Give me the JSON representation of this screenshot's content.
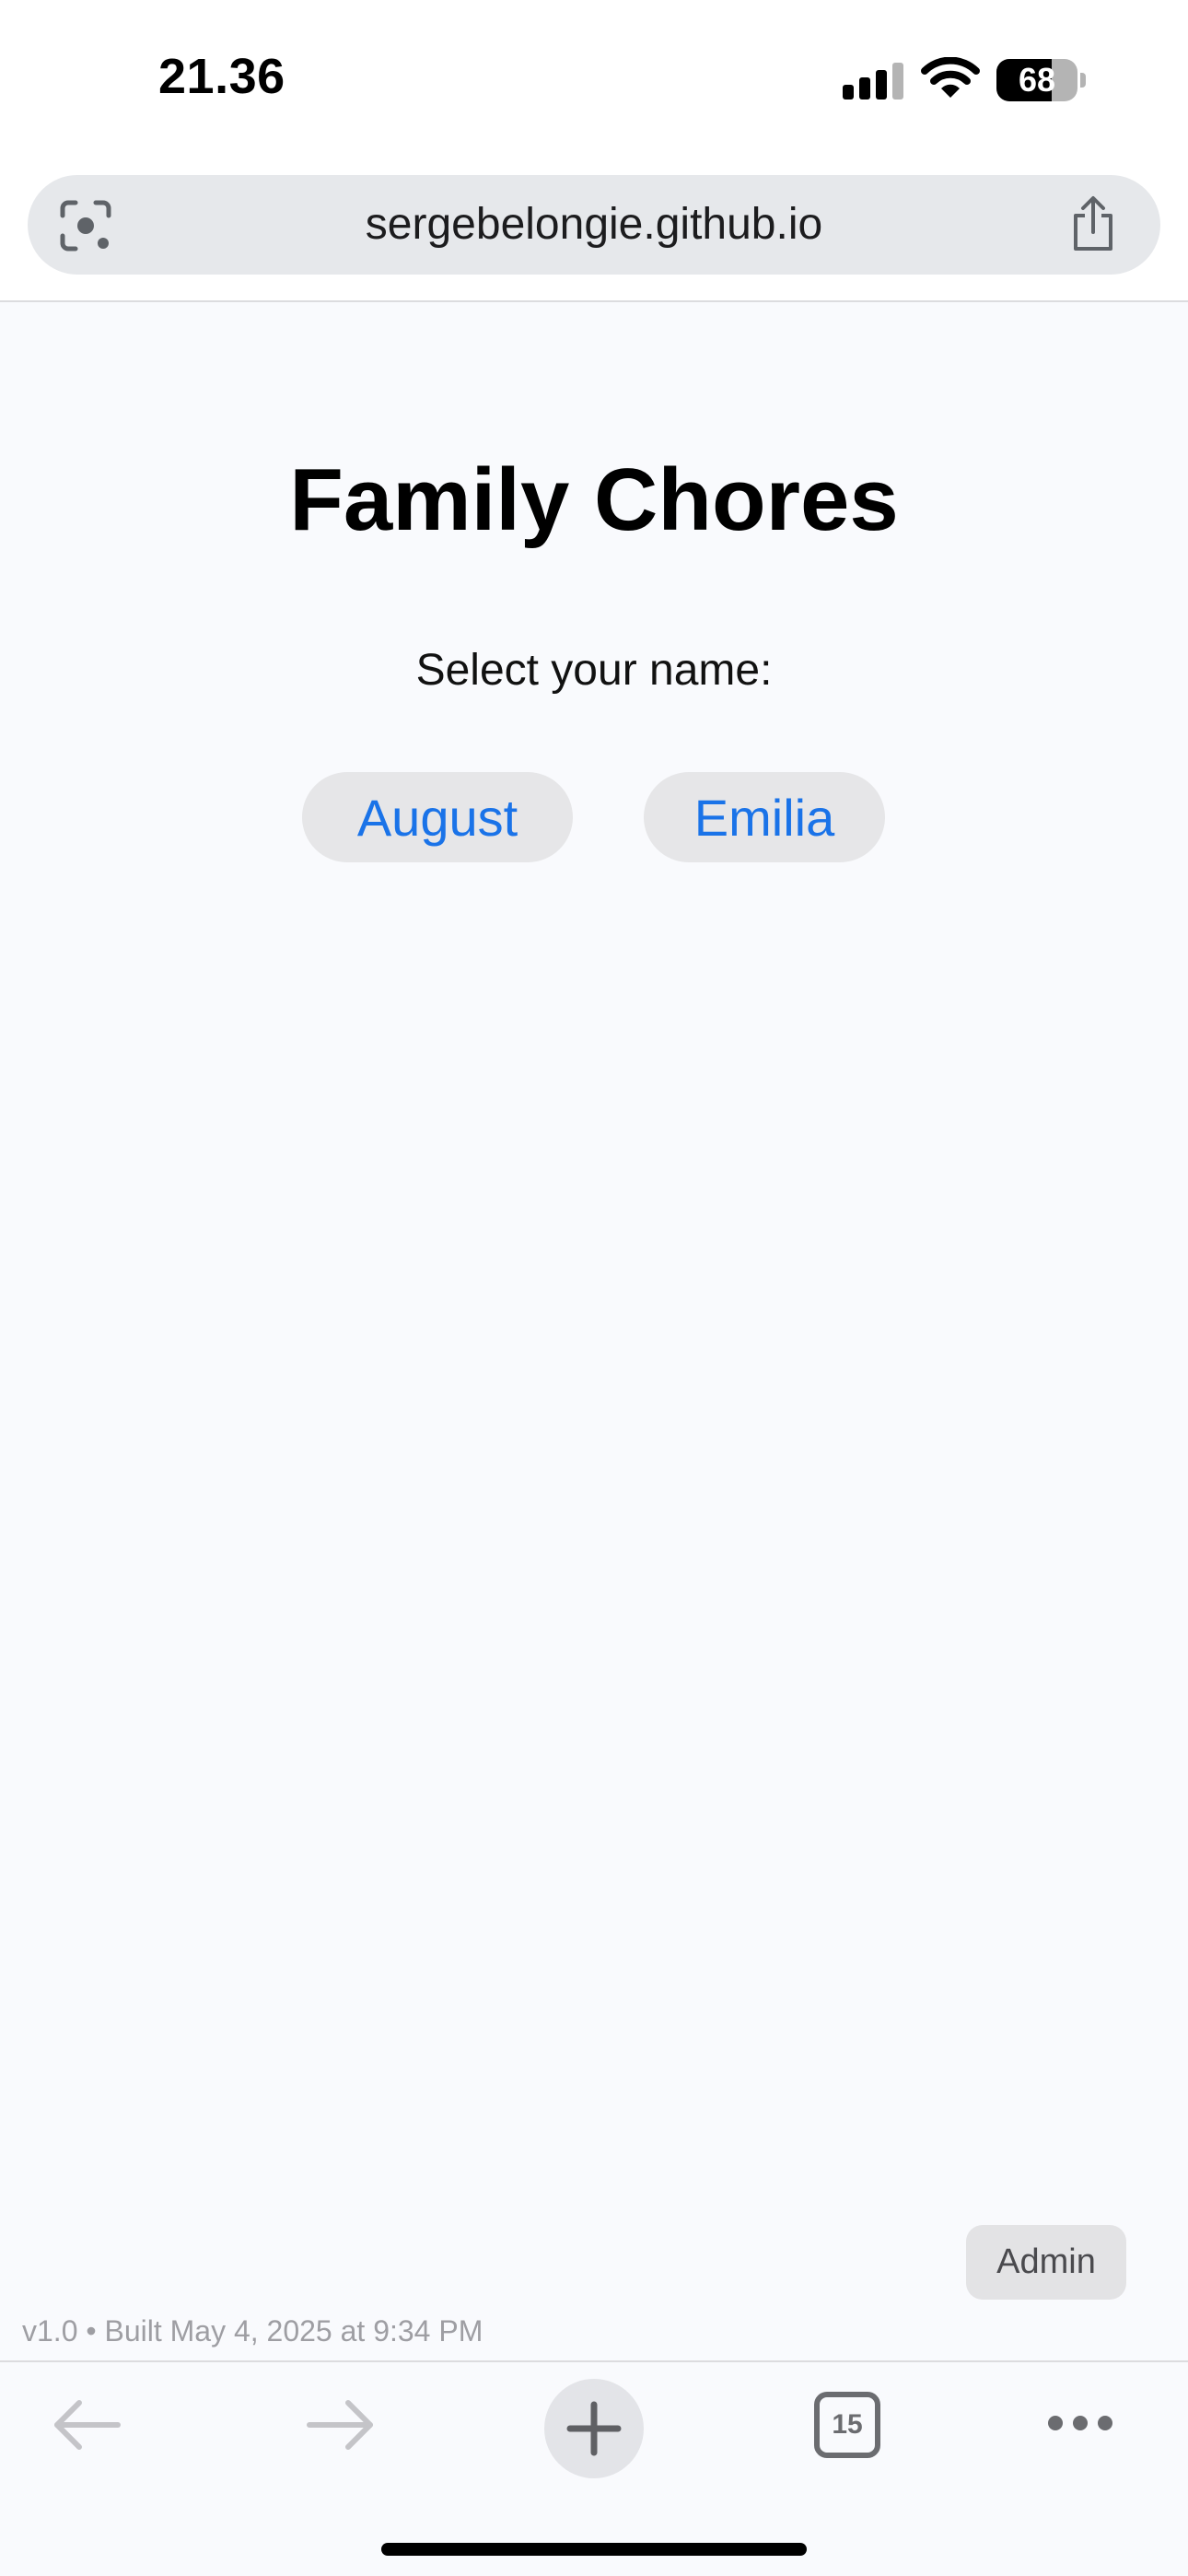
{
  "status_bar": {
    "time": "21.36",
    "battery_percent": 68,
    "battery_label": "68",
    "signal_icon": "cellular-signal-icon",
    "wifi_icon": "wifi-icon"
  },
  "browser": {
    "url": "sergebelongie.github.io",
    "left_icon": "visual-lookup-icon",
    "right_icon": "share-icon",
    "toolbar": {
      "back_icon": "back-arrow-icon",
      "forward_icon": "forward-arrow-icon",
      "new_tab_icon": "plus-icon",
      "tab_count": "15",
      "more_icon": "more-dots-icon"
    }
  },
  "page": {
    "title": "Family Chores",
    "prompt": "Select your name:",
    "names": [
      "August",
      "Emilia"
    ],
    "admin_label": "Admin",
    "version_text": "v1.0 • Built May 4, 2025 at 9:34 PM"
  },
  "colors": {
    "link_blue": "#1a73e8",
    "page_background": "#f9fafd",
    "button_background": "#e6e6e8"
  }
}
